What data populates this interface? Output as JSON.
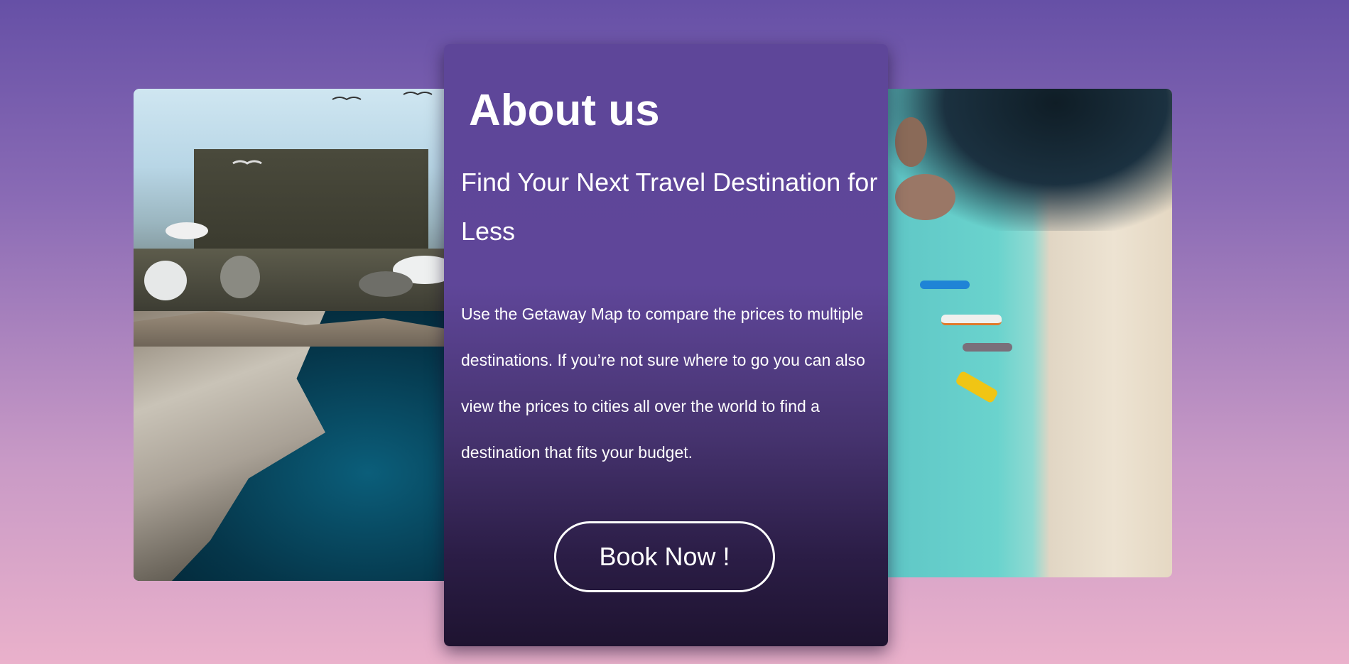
{
  "about": {
    "title": "About us",
    "subtitle": "Find Your Next Travel Destination for Less",
    "body": "Use the Getaway Map to compare the prices to multiple destinations. If you’re not sure where to go you can also view the prices to cities all over the world to find a destination that fits your budget.",
    "button_label": "Book Now !"
  },
  "images": {
    "left": "travel-collage-photo",
    "right": "beach-aerial-photo"
  },
  "colors": {
    "card_top": "#5e4699",
    "card_bottom": "#1e1330",
    "background_top": "#6650a6",
    "background_bottom": "#eab1cb"
  }
}
